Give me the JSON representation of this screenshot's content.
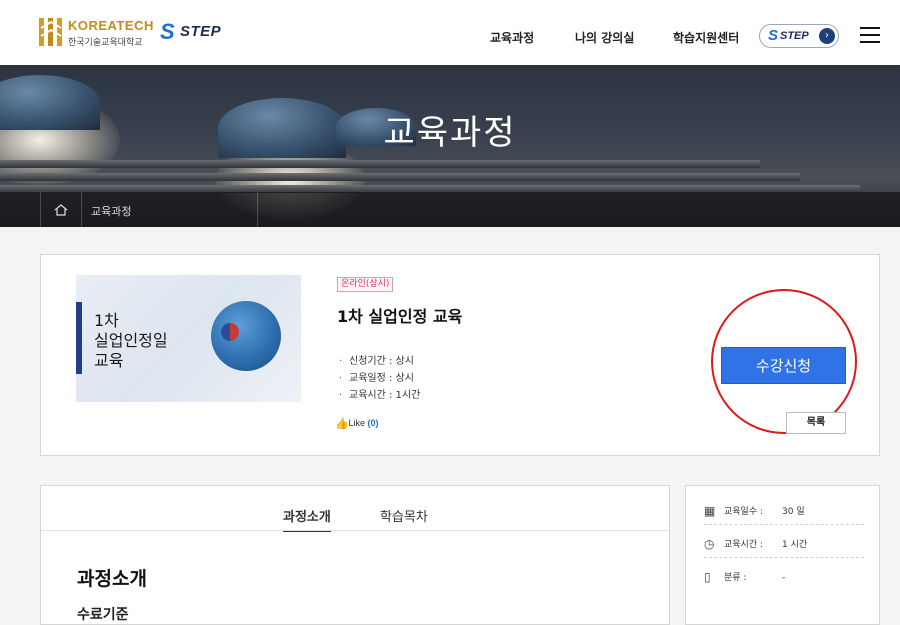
{
  "header": {
    "logo_name": "KOREATECH",
    "logo_sub": "한국기술교육대학교",
    "step_logo": "STEP",
    "nav": [
      "교육과정",
      "나의 강의실",
      "학습지원센터"
    ],
    "step_badge": "STEP",
    "icons": {
      "menu": "hamburger-icon",
      "arrow": "chevron-right-icon"
    }
  },
  "banner": {
    "title": "교육과정",
    "breadcrumb": "교육과정"
  },
  "course": {
    "thumb_title": "1차\n실업인정일\n교육",
    "thumb_logo_text": "",
    "badge": "온라인(상시)",
    "title": "1차 실업인정 교육",
    "info": [
      {
        "label": "신청기간",
        "value": "상시"
      },
      {
        "label": "교육일정",
        "value": "상시"
      },
      {
        "label": "교육시간",
        "value": "1시간"
      }
    ],
    "like_label": "Like",
    "like_count": "(0)",
    "enroll_button": "수강신청",
    "list_button": "목록",
    "accent_color": "#2f73e6",
    "highlight_color": "#e01818"
  },
  "tabs": [
    {
      "label": "과정소개",
      "active": true
    },
    {
      "label": "학습목차",
      "active": false
    }
  ],
  "intro": {
    "title": "과정소개",
    "subtitle": "수료기준"
  },
  "stats": [
    {
      "icon": "calendar-icon",
      "label": "교육일수 :",
      "value": "30 일"
    },
    {
      "icon": "alarm-clock-icon",
      "label": "교육시간 :",
      "value": "1 시간"
    },
    {
      "icon": "document-icon",
      "label": "분류 :",
      "value": "-"
    }
  ]
}
